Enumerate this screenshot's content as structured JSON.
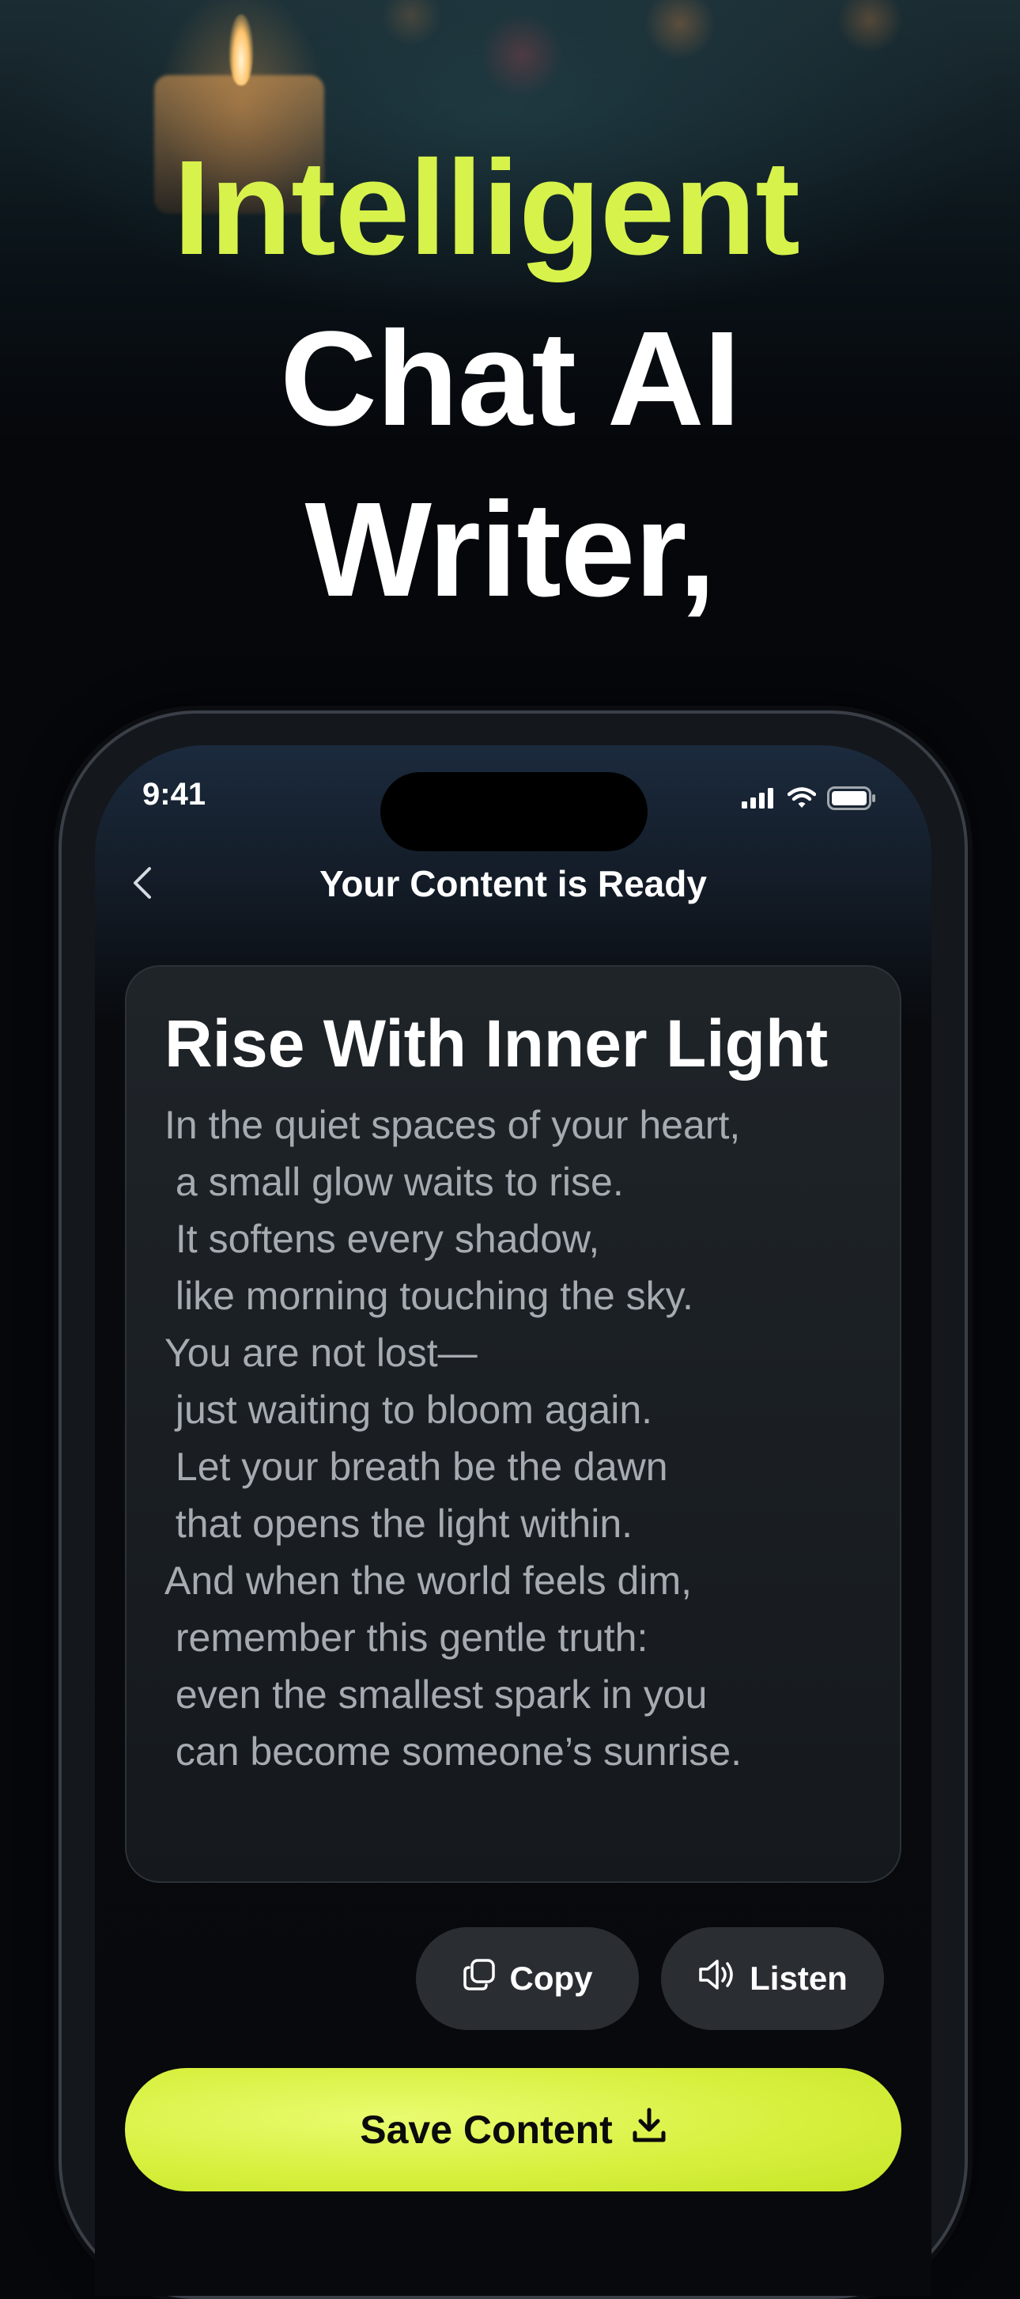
{
  "hero": {
    "line1": "Intelligent",
    "line2": "Chat AI",
    "line3": "Writer,"
  },
  "status_bar": {
    "time": "9:41",
    "icons": [
      "signal-icon",
      "wifi-icon",
      "battery-icon"
    ]
  },
  "nav": {
    "back_icon": "chevron-left-icon",
    "title": "Your Content is Ready"
  },
  "content": {
    "title": "Rise With Inner Light",
    "lines": [
      "In the quiet spaces of your heart,",
      " a small glow waits to rise.",
      " It softens every shadow,",
      " like morning touching the sky.",
      "You are not lost—",
      " just waiting to bloom again.",
      " Let your breath be the dawn",
      " that opens the light within.",
      "And when the world feels dim,",
      " remember this gentle truth:",
      " even the smallest spark in you",
      " can become someone’s sunrise."
    ]
  },
  "actions": {
    "copy_label": "Copy",
    "copy_icon": "copy-icon",
    "listen_label": "Listen",
    "listen_icon": "speaker-icon"
  },
  "save": {
    "label": "Save Content",
    "icon": "download-icon"
  },
  "colors": {
    "accent": "#d7f24b",
    "background": "#05070b",
    "card": "#1b1f24",
    "pill_button": "#2a2e33"
  }
}
